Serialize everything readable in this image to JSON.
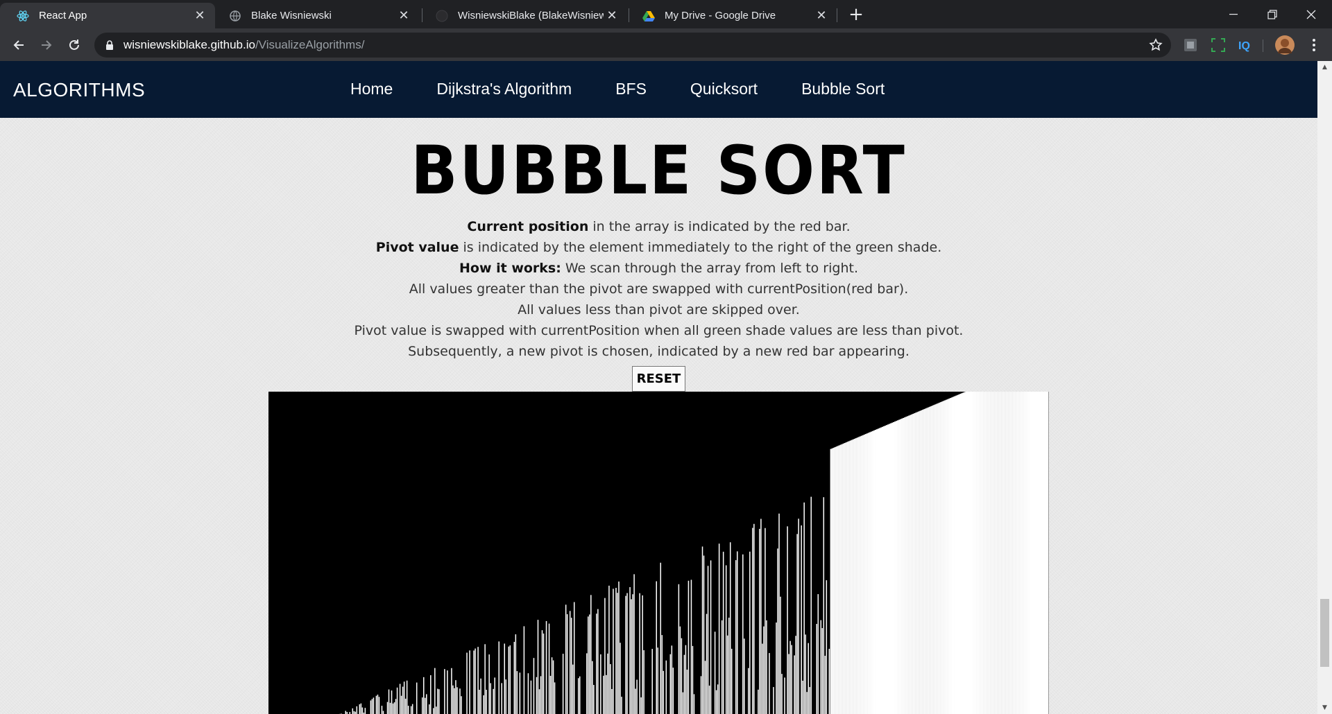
{
  "browser": {
    "tabs": [
      {
        "title": "React App",
        "active": true,
        "icon": "react-icon"
      },
      {
        "title": "Blake Wisniewski",
        "active": false,
        "icon": "globe-icon"
      },
      {
        "title": "WisniewskiBlake (BlakeWisniewski",
        "active": false,
        "icon": "github-icon"
      },
      {
        "title": "My Drive - Google Drive",
        "active": false,
        "icon": "google-drive-icon"
      }
    ],
    "url_host": "wisniewskiblake.github.io",
    "url_path": "/VisualizeAlgorithms/"
  },
  "app": {
    "brand": "ALGORITHMS",
    "nav": [
      "Home",
      "Dijkstra's Algorithm",
      "BFS",
      "Quicksort",
      "Bubble Sort"
    ]
  },
  "page": {
    "title": "BUBBLE SORT",
    "lines": [
      {
        "bold": "Current position",
        "text": " in the array is indicated by the red bar."
      },
      {
        "bold": "Pivot value",
        "text": " is indicated by the element immediately to the right of the green shade."
      },
      {
        "bold": "How it works:",
        "text": " We scan through the array from left to right."
      },
      {
        "bold": "",
        "text": "All values greater than the pivot are swapped with currentPosition(red bar)."
      },
      {
        "bold": "",
        "text": "All values less than pivot are skipped over."
      },
      {
        "bold": "",
        "text": "Pivot value is swapped with currentPosition when all green shade values are less than pivot."
      },
      {
        "bold": "",
        "text": "Subsequently, a new pivot is chosen, indicated by a new red bar appearing."
      }
    ],
    "reset_label": "RESET"
  },
  "visualization": {
    "bar_color": "#ffffff",
    "background_color": "#000000",
    "sorted_fraction": 0.28
  }
}
